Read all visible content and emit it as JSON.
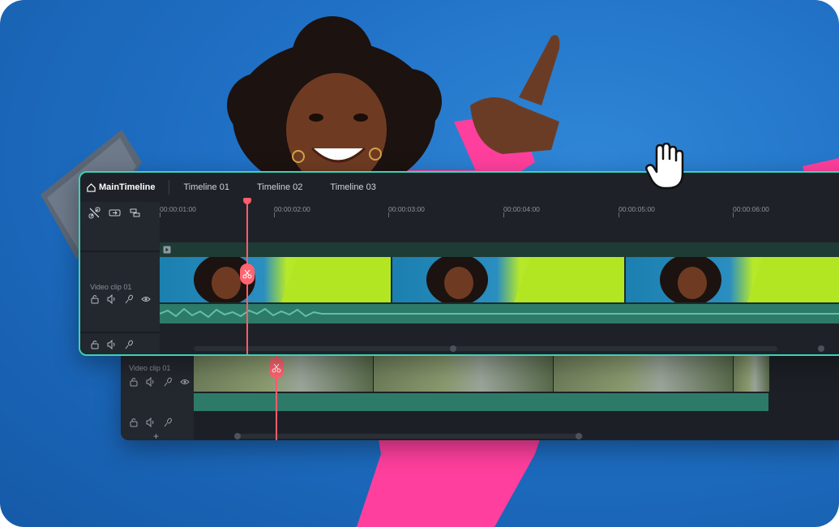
{
  "timeline": {
    "tabs": [
      {
        "label": "MainTimeline",
        "active": true
      },
      {
        "label": "Timeline 01",
        "active": false
      },
      {
        "label": "Timeline 02",
        "active": false
      },
      {
        "label": "Timeline 03",
        "active": false
      }
    ],
    "ruler": [
      "00:00:01:00",
      "00:00:02:00",
      "00:00:03:00",
      "00:00:04:00",
      "00:00:05:00",
      "00:00:06:00"
    ],
    "main_clip_label": "Video clip 01",
    "back_clip_label": "Video clip 01",
    "add_track_label": "+"
  },
  "colors": {
    "accent": "#3ad3b8",
    "playhead": "#ff5d6a",
    "background_sky": "#1f6fc4",
    "shirt": "#ff3f9d"
  },
  "icons": [
    "home-icon",
    "unlink-icon",
    "split-icon",
    "marker-icon",
    "video-track-icon",
    "lock-icon",
    "audio-icon",
    "mic-icon",
    "eye-icon",
    "scissors-icon",
    "hand-cursor-icon"
  ]
}
